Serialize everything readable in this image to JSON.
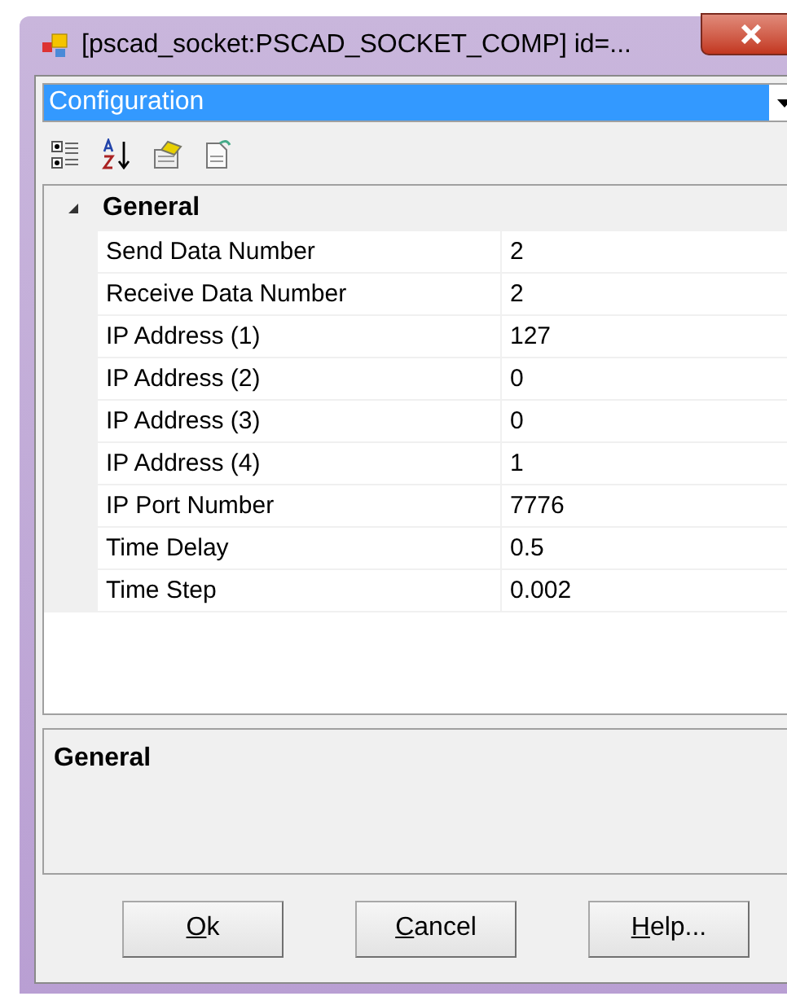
{
  "window": {
    "title": "[pscad_socket:PSCAD_SOCKET_COMP] id=..."
  },
  "object_selector": {
    "value": "Configuration"
  },
  "toolbar": [
    {
      "kind": "categorized",
      "selected": false
    },
    {
      "kind": "alphabetical",
      "selected": false
    },
    {
      "kind": "properties",
      "selected": false
    },
    {
      "kind": "pages",
      "selected": false
    }
  ],
  "grid": {
    "category": {
      "label": "General",
      "expanded": true
    },
    "rows": [
      {
        "name": "Send Data Number",
        "value": "2"
      },
      {
        "name": "Receive Data Number",
        "value": "2"
      },
      {
        "name": "IP Address (1)",
        "value": "127"
      },
      {
        "name": "IP Address (2)",
        "value": "0"
      },
      {
        "name": "IP Address (3)",
        "value": "0"
      },
      {
        "name": "IP Address (4)",
        "value": "1"
      },
      {
        "name": "IP Port Number",
        "value": "7776"
      },
      {
        "name": "Time Delay",
        "value": "0.5"
      },
      {
        "name": "Time Step",
        "value": "0.002"
      }
    ]
  },
  "description": {
    "title": "General"
  },
  "buttons": [
    {
      "label": "Ok",
      "mnemonic_underlined": true
    },
    {
      "label": "Cancel",
      "mnemonic_underlined": true
    },
    {
      "label": "Help...",
      "mnemonic_underlined": true
    }
  ]
}
